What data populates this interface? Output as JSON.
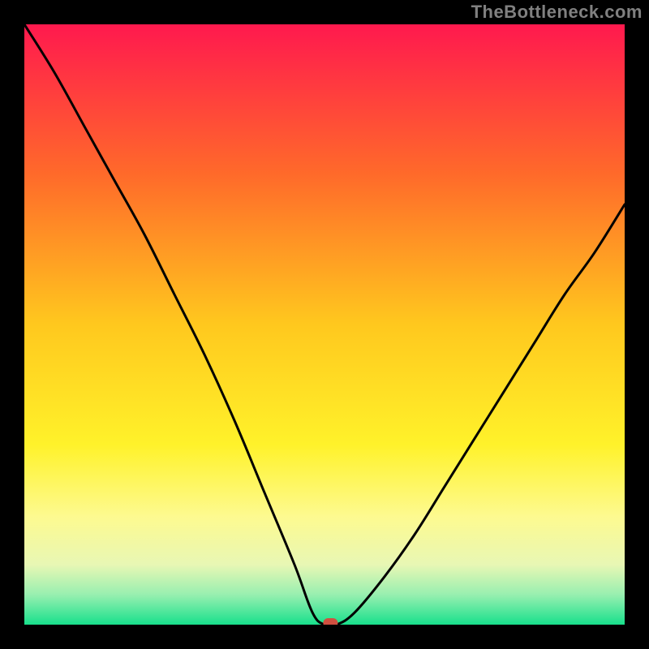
{
  "watermark": "TheBottleneck.com",
  "chart_data": {
    "type": "line",
    "title": "",
    "xlabel": "",
    "ylabel": "",
    "xlim": [
      0,
      100
    ],
    "ylim": [
      0,
      100
    ],
    "grid": false,
    "legend": false,
    "background_gradient": {
      "stops": [
        {
          "offset": 0.0,
          "color": "#ff194e"
        },
        {
          "offset": 0.25,
          "color": "#ff6a2a"
        },
        {
          "offset": 0.5,
          "color": "#ffc81e"
        },
        {
          "offset": 0.7,
          "color": "#fff22a"
        },
        {
          "offset": 0.82,
          "color": "#fdfa90"
        },
        {
          "offset": 0.9,
          "color": "#e8f7b4"
        },
        {
          "offset": 0.95,
          "color": "#98efb0"
        },
        {
          "offset": 1.0,
          "color": "#18e08c"
        }
      ]
    },
    "series": [
      {
        "name": "bottleneck-curve",
        "x": [
          0,
          5,
          10,
          15,
          20,
          25,
          30,
          35,
          40,
          45,
          48,
          50,
          52,
          55,
          60,
          65,
          70,
          75,
          80,
          85,
          90,
          95,
          100
        ],
        "y": [
          100,
          92,
          83,
          74,
          65,
          55,
          45,
          34,
          22,
          10,
          2,
          0,
          0,
          2,
          8,
          15,
          23,
          31,
          39,
          47,
          55,
          62,
          70
        ]
      }
    ],
    "marker": {
      "name": "optimum-point",
      "x": 51,
      "y": 0,
      "color": "#d05040"
    }
  }
}
